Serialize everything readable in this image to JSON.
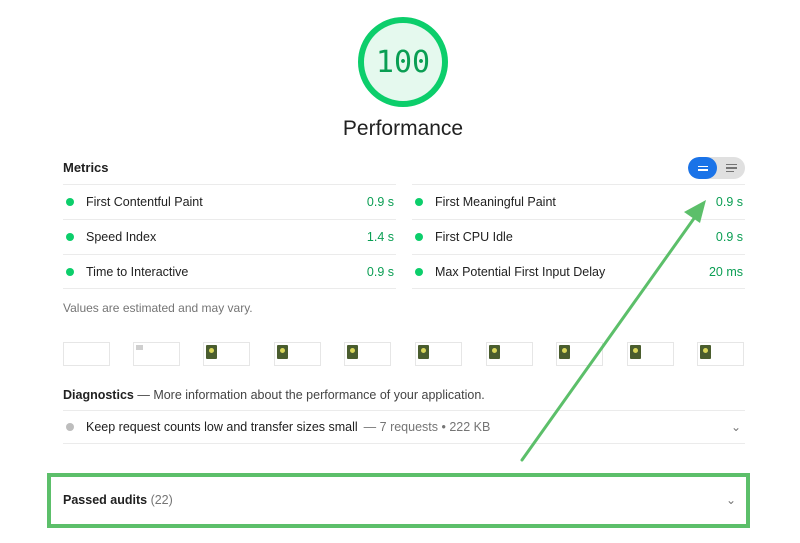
{
  "category": {
    "score": "100",
    "title": "Performance"
  },
  "metrics": {
    "header": "Metrics",
    "items": [
      {
        "label": "First Contentful Paint",
        "value": "0.9 s"
      },
      {
        "label": "First Meaningful Paint",
        "value": "0.9 s"
      },
      {
        "label": "Speed Index",
        "value": "1.4 s"
      },
      {
        "label": "First CPU Idle",
        "value": "0.9 s"
      },
      {
        "label": "Time to Interactive",
        "value": "0.9 s"
      },
      {
        "label": "Max Potential First Input Delay",
        "value": "20 ms"
      }
    ],
    "disclaimer": "Values are estimated and may vary."
  },
  "diagnostics": {
    "title": "Diagnostics",
    "description": "— More information about the performance of your application.",
    "items": [
      {
        "title": "Keep request counts low and transfer sizes small",
        "meta": "— 7 requests • 222 KB"
      }
    ]
  },
  "passed_audits": {
    "label": "Passed audits",
    "count": "(22)"
  },
  "colors": {
    "pass": "#0cce6b",
    "toggle_active": "#1a73e8",
    "highlight": "#5cbf6a"
  }
}
